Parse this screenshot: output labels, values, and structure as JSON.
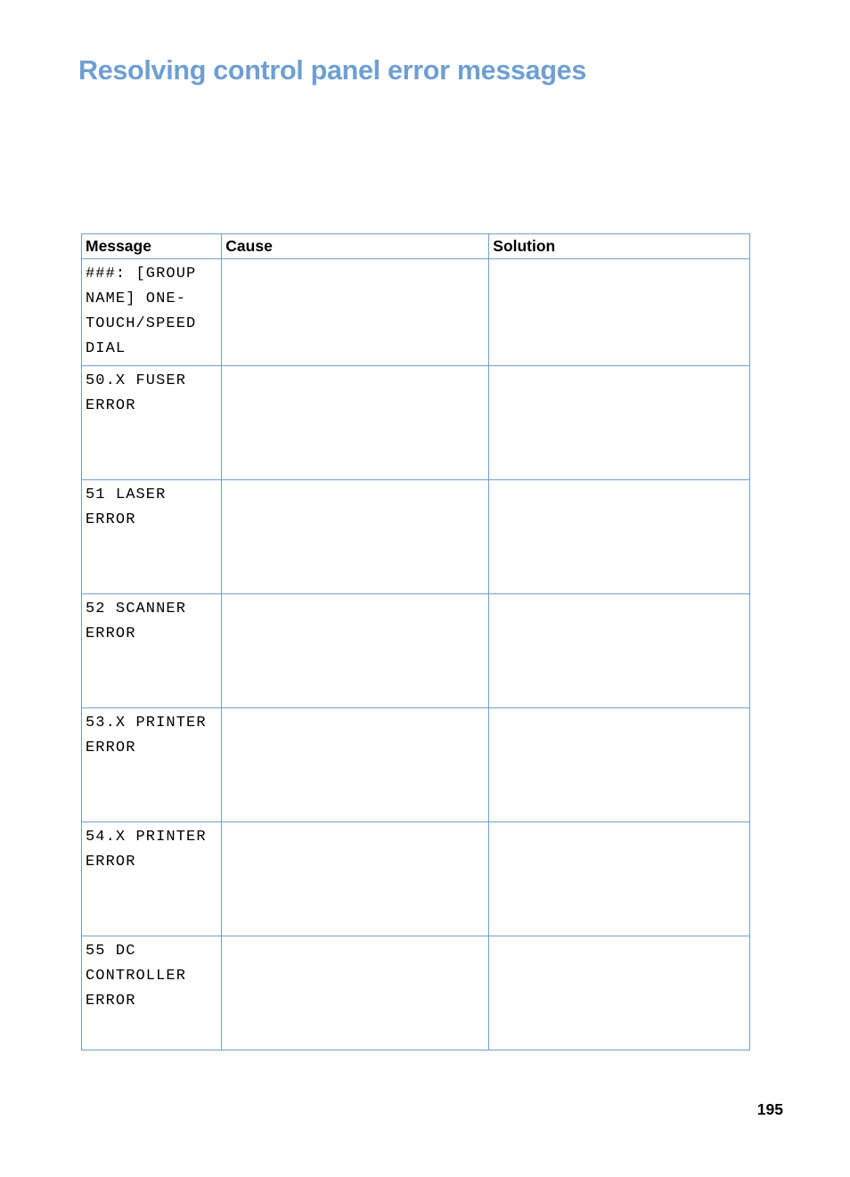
{
  "headline": "Resolving control panel error messages",
  "page_number": "195",
  "table": {
    "headers": {
      "message": "Message",
      "cause": "Cause",
      "solution": "Solution"
    },
    "rows": [
      {
        "message": "###: [GROUP NAME] ONE-TOUCH/SPEED DIAL",
        "cause": "",
        "solution": ""
      },
      {
        "message": "50.X FUSER ERROR",
        "cause": "",
        "solution": ""
      },
      {
        "message": "51 LASER ERROR",
        "cause": "",
        "solution": ""
      },
      {
        "message": "52 SCANNER ERROR",
        "cause": "",
        "solution": ""
      },
      {
        "message": "53.X PRINTER ERROR",
        "cause": "",
        "solution": ""
      },
      {
        "message": "54.X PRINTER ERROR",
        "cause": "",
        "solution": ""
      },
      {
        "message": "55 DC CONTROLLER ERROR",
        "cause": "",
        "solution": ""
      }
    ]
  }
}
